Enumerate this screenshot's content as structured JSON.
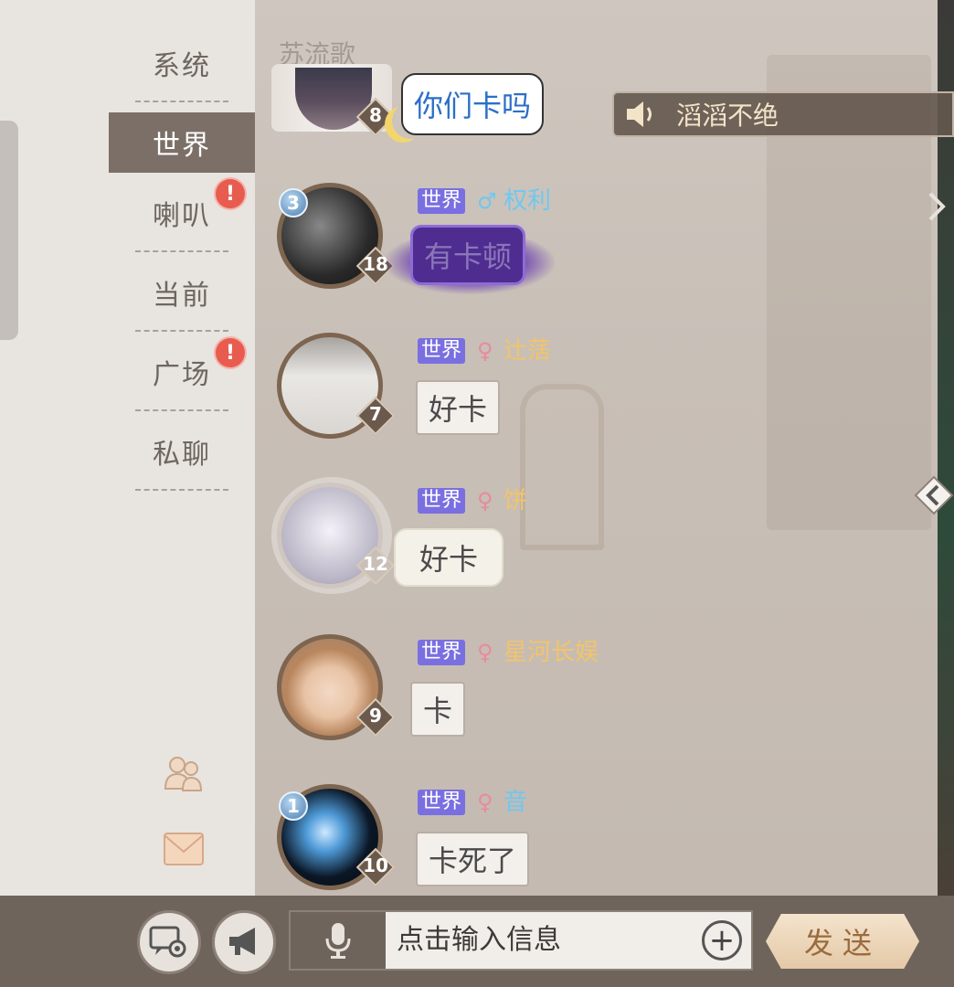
{
  "sidebar": {
    "tabs": [
      {
        "label": "系统"
      },
      {
        "label": "世界"
      },
      {
        "label": "喇叭"
      },
      {
        "label": "当前"
      },
      {
        "label": "广场"
      },
      {
        "label": "私聊"
      }
    ],
    "alert_glyph": "!",
    "icons": [
      "friends-icon",
      "mail-icon"
    ]
  },
  "background_text": {
    "name": "苏流歌"
  },
  "broadcast": {
    "text": "滔滔不绝"
  },
  "messages": [
    {
      "channel": "",
      "gender": "",
      "name": "",
      "level": "8",
      "rank": "",
      "text": "你们卡吗"
    },
    {
      "channel": "世界",
      "gender": "♂",
      "gender_color": "#6fc8ef",
      "name": "权利",
      "name_color": "#6fc8ef",
      "level": "18",
      "rank": "3",
      "text": "有卡顿"
    },
    {
      "channel": "世界",
      "gender": "♀",
      "gender_color": "#e88aa0",
      "name": "辻萿",
      "name_color": "#f2c46a",
      "level": "7",
      "rank": "",
      "text": "好卡"
    },
    {
      "channel": "世界",
      "gender": "♀",
      "gender_color": "#e88aa0",
      "name": "饼",
      "name_color": "#f2c46a",
      "level": "12",
      "rank": "",
      "text": "好卡"
    },
    {
      "channel": "世界",
      "gender": "♀",
      "gender_color": "#e88aa0",
      "name": "星河长娱",
      "name_color": "#f2c46a",
      "level": "9",
      "rank": "",
      "text": "卡"
    },
    {
      "channel": "世界",
      "gender": "♀",
      "gender_color": "#e88aa0",
      "name": "音",
      "name_color": "#6fc8ef",
      "level": "10",
      "rank": "1",
      "text": "卡死了"
    }
  ],
  "input": {
    "placeholder": "点击输入信息",
    "send_label": "发送"
  }
}
